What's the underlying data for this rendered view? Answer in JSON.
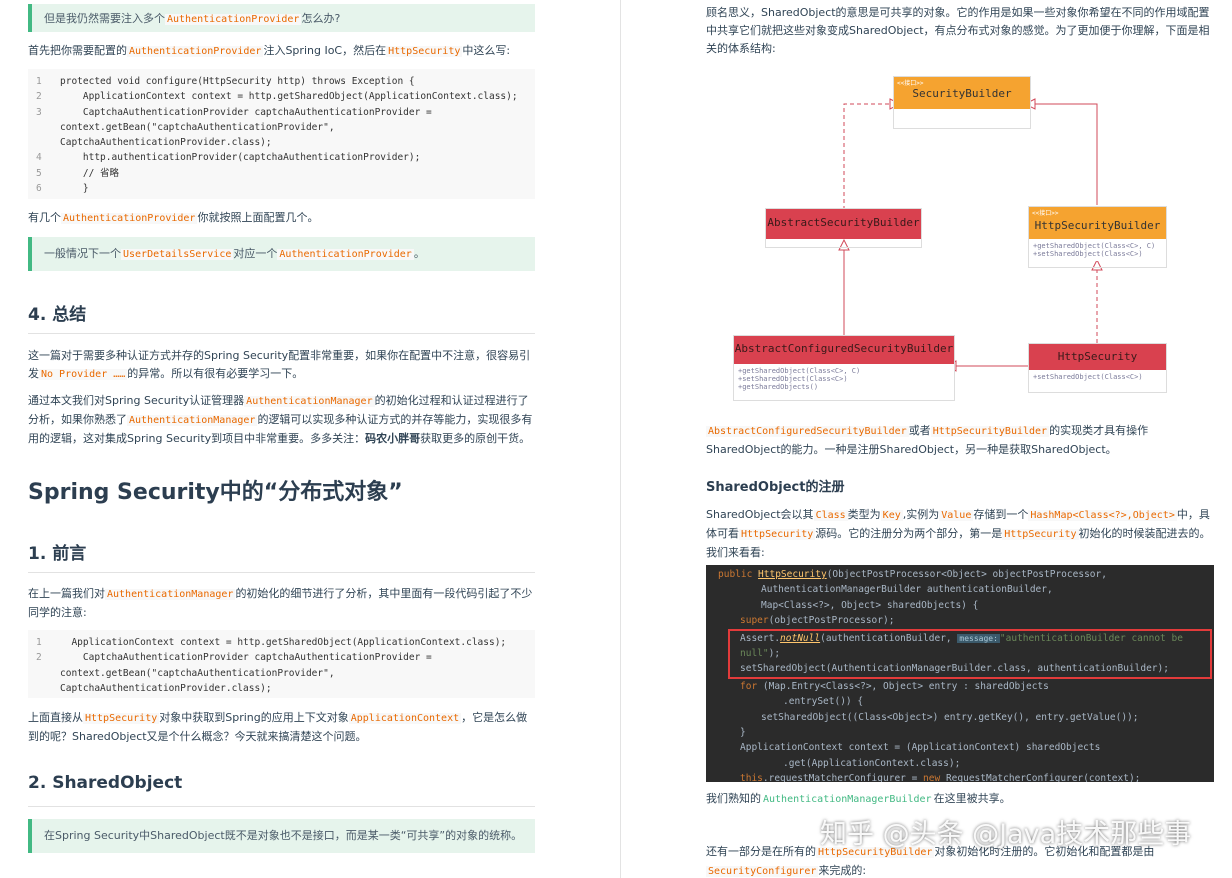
{
  "left": {
    "tip1": {
      "pre": "但是我仍然需要注入多个",
      "code": "AuthenticationProvider",
      "post": "怎么办?"
    },
    "p1": {
      "pre": "首先把你需要配置的",
      "code1": "AuthenticationProvider",
      "mid": "注入Spring IoC，然后在",
      "code2": "HttpSecurity",
      "post": "中这么写:"
    },
    "code1": [
      {
        "n": "1",
        "text": "protected void configure(HttpSecurity http) throws Exception {"
      },
      {
        "n": "2",
        "text": "    ApplicationContext context = http.getSharedObject(ApplicationContext.class);"
      },
      {
        "n": "3",
        "text": "    CaptchaAuthenticationProvider captchaAuthenticationProvider = context.getBean(\"captchaAuthenticationProvider\", CaptchaAuthenticationProvider.class);"
      },
      {
        "n": "4",
        "text": "    http.authenticationProvider(captchaAuthenticationProvider);"
      },
      {
        "n": "5",
        "text": "    // 省略"
      },
      {
        "n": "6",
        "text": "    }"
      }
    ],
    "p2": {
      "pre": "有几个",
      "code": "AuthenticationProvider",
      "post": "你就按照上面配置几个。"
    },
    "tip2": {
      "pre": "一般情况下一个",
      "code1": "UserDetailsService",
      "mid": "对应一个",
      "code2": "AuthenticationProvider",
      "post": "。"
    },
    "h_summary": "4. 总结",
    "p3": {
      "pre": "这一篇对于需要多种认证方式并存的Spring Security配置非常重要，如果你在配置中不注意，很容易引发",
      "code": "No Provider ……",
      "post": "的异常。所以有很有必要学习一下。"
    },
    "p4": {
      "pre": "通过本文我们对Spring Security认证管理器",
      "code1": "AuthenticationManager",
      "mid": "的初始化过程和认证过程进行了分析，如果你熟悉了",
      "code2": "AuthenticationManager",
      "post": "的逻辑可以实现多种认证方式的并存等能力，实现很多有用的逻辑，这对集成Spring Security到项目中非常重要。多多关注：",
      "bold": "码农小胖哥",
      "tail": "获取更多的原创干货。"
    },
    "h_title": "Spring Security中的“分布式对象”",
    "h_intro": "1. 前言",
    "p5": {
      "pre": "在上一篇我们对",
      "code": "AuthenticationManager",
      "post": "的初始化的细节进行了分析，其中里面有一段代码引起了不少同学的注意:"
    },
    "code2": [
      {
        "n": "1",
        "text": "  ApplicationContext context = http.getSharedObject(ApplicationContext.class);"
      },
      {
        "n": "2",
        "text": "    CaptchaAuthenticationProvider captchaAuthenticationProvider = context.getBean(\"captchaAuthenticationProvider\", CaptchaAuthenticationProvider.class);"
      }
    ],
    "p6": {
      "pre": "上面直接从",
      "code1": "HttpSecurity",
      "mid": "对象中获取到Spring的应用上下文对象",
      "code2": "ApplicationContext",
      "post": "，它是怎么做到的呢？SharedObject又是个什么概念？今天就来搞清楚这个问题。"
    },
    "h_shared": "2. SharedObject",
    "tip3": "在Spring Security中SharedObject既不是对象也不是接口，而是某一类“可共享”的对象的统称。"
  },
  "right": {
    "p1": "顾名思义，SharedObject的意思是可共享的对象。它的作用是如果一些对象你希望在不同的作用域配置中共享它们就把这些对象变成SharedObject，有点分布式对象的感觉。为了更加便于你理解，下面是相关的体系结构:",
    "diagram": {
      "security_builder": {
        "stereo": "<<接口>>",
        "name": "SecurityBuilder"
      },
      "abstract_builder": {
        "name": "AbstractSecurityBuilder"
      },
      "http_builder": {
        "stereo": "<<接口>>",
        "name": "HttpSecurityBuilder",
        "methods": "+getSharedObject(Class<C>, C)\n+setSharedObject(Class<C>)"
      },
      "configured_builder": {
        "name": "AbstractConfiguredSecurityBuilder",
        "methods": "+getSharedObject(Class<C>, C)\n+setSharedObject(Class<C>)\n+getSharedObjects()"
      },
      "http_security": {
        "name": "HttpSecurity",
        "methods": "+setSharedObject(Class<C>)"
      }
    },
    "p2": {
      "code1": "AbstractConfiguredSecurityBuilder",
      "mid": "或者",
      "code2": "HttpSecurityBuilder",
      "post": "的实现类才具有操作SharedObject的能力。一种是注册SharedObject，另一种是获取SharedObject。"
    },
    "h_register": "SharedObject的注册",
    "p3": {
      "pre": "SharedObject会以其",
      "c1": "Class",
      "t1": "类型为",
      "c2": "Key",
      "t2": ",实例为",
      "c3": "Value",
      "t3": "存储到一个",
      "c4": "HashMap<Class<?>,Object>",
      "t4": "中，具体可看",
      "c5": "HttpSecurity",
      "t5": "源码。它的注册分为两个部分，第一是",
      "c6": "HttpSecurity",
      "t6": "初始化的时候装配进去的。我们来看看:"
    },
    "ide": {
      "l1a": "public ",
      "l1b": "HttpSecurity",
      "l1c": "(ObjectPostProcessor<Object> objectPostProcessor,",
      "l2": "AuthenticationManagerBuilder authenticationBuilder,",
      "l3": "Map<Class<?>, Object> sharedObjects) {",
      "l4a": "super",
      "l4b": "(objectPostProcessor);",
      "l5a": "Assert.",
      "l5b": "notNull",
      "l5c": "(authenticationBuilder, ",
      "l5d": "message:",
      "l5e": "\"authenticationBuilder cannot be null\"",
      "l5f": ");",
      "l6": "setSharedObject(AuthenticationManagerBuilder.class, authenticationBuilder);",
      "l7a": "for ",
      "l7b": "(Map.Entry<Class<?>, Object> entry : sharedObjects",
      "l8": ".entrySet()) {",
      "l9": "setSharedObject((Class<Object>) entry.getKey(), entry.getValue());",
      "l10": "}",
      "l11": "ApplicationContext context = (ApplicationContext) sharedObjects",
      "l12": ".get(ApplicationContext.class);",
      "l13a": "this",
      "l13b": ".requestMatcherConfigurer = ",
      "l13c": "new ",
      "l13d": "RequestMatcherConfigurer(context);"
    },
    "p4": {
      "pre": "我们熟知的",
      "code": "AuthenticationManagerBuilder",
      "post": "在这里被共享。"
    },
    "p5": {
      "pre": "还有一部分是在所有的",
      "code1": "HttpSecurityBuilder",
      "mid": "对象初始化时注册的。它初始化和配置都是由",
      "code2": "SecurityConfigurer",
      "post": "来完成的:"
    },
    "watermark": "知乎 @头条 @Java技术那些事"
  }
}
